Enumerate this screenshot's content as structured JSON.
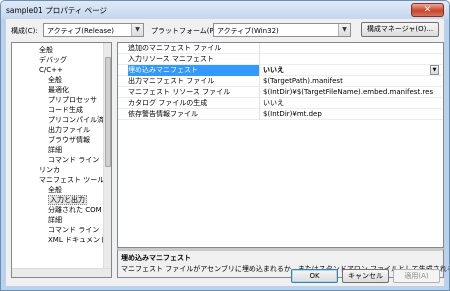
{
  "window": {
    "title": "sample01 プロパティ ページ",
    "close_symbol": "✕"
  },
  "toolbar": {
    "config_label": "構成(C):",
    "config_value": "アクティブ(Release)",
    "platform_label": "プラットフォーム(P):",
    "platform_value": "アクティブ(Win32)",
    "config_manager_label": "構成マネージャ(O)...",
    "dropdown_symbol": "▼"
  },
  "tree": {
    "items": [
      "全般",
      "デバッグ",
      "C/C++",
      "全般",
      "最適化",
      "プリプロセッサ",
      "コード生成",
      "プリコンパイル済ヘ",
      "出力ファイル",
      "ブラウザ情報",
      "詳細",
      "コマンド ライン",
      "リンカ",
      "マニフェスト ツール",
      "全般",
      "入力と出力",
      "分離された COM",
      "詳細",
      "コマンド ライン",
      "XML ドキュメント ジ"
    ]
  },
  "grid": {
    "rows": [
      {
        "name": "追加のマニフェスト ファイル",
        "value": ""
      },
      {
        "name": "入力リソース マニフェスト",
        "value": ""
      },
      {
        "name": "埋め込みマニフェスト",
        "value": "いいえ"
      },
      {
        "name": "出力マニフェスト ファイル",
        "value": "$(TargetPath).manifest"
      },
      {
        "name": "マニフェスト リソース ファイル",
        "value": "$(IntDir)¥$(TargetFileName).embed.manifest.res"
      },
      {
        "name": "カタログ ファイルの生成",
        "value": "いいえ"
      },
      {
        "name": "依存警告情報ファイル",
        "value": "$(IntDir)¥mt.dep"
      }
    ]
  },
  "description": {
    "title": "埋め込みマニフェスト",
    "text": "マニフェスト ファイルがアセンブリに埋め込まれるか、またはスタンドアロン ファイルとして生成されるかを…"
  },
  "buttons": {
    "ok": "OK",
    "cancel": "キャンセル",
    "apply": "適用(A)"
  }
}
